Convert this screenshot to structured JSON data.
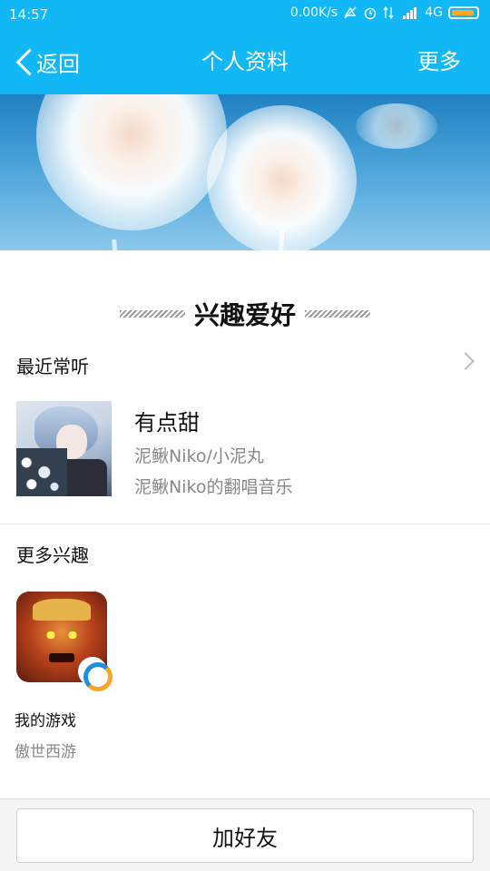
{
  "status_bar": {
    "time": "14:57",
    "net_speed": "0.00K/s",
    "network": "4G"
  },
  "nav": {
    "back_label": "返回",
    "title": "个人资料",
    "more_label": "更多"
  },
  "interests": {
    "section_title": "兴趣爱好",
    "recent_listen": {
      "label": "最近常听",
      "song_title": "有点甜",
      "artist": "泥鳅Niko/小泥丸",
      "description": "泥鳅Niko的翻唱音乐"
    },
    "more_interests": {
      "label": "更多兴趣",
      "game_label": "我的游戏",
      "game_name": "傲世西游"
    }
  },
  "bottom": {
    "add_friend_label": "加好友"
  },
  "colors": {
    "header": "#12b7f5",
    "battery": "#ffa726"
  }
}
